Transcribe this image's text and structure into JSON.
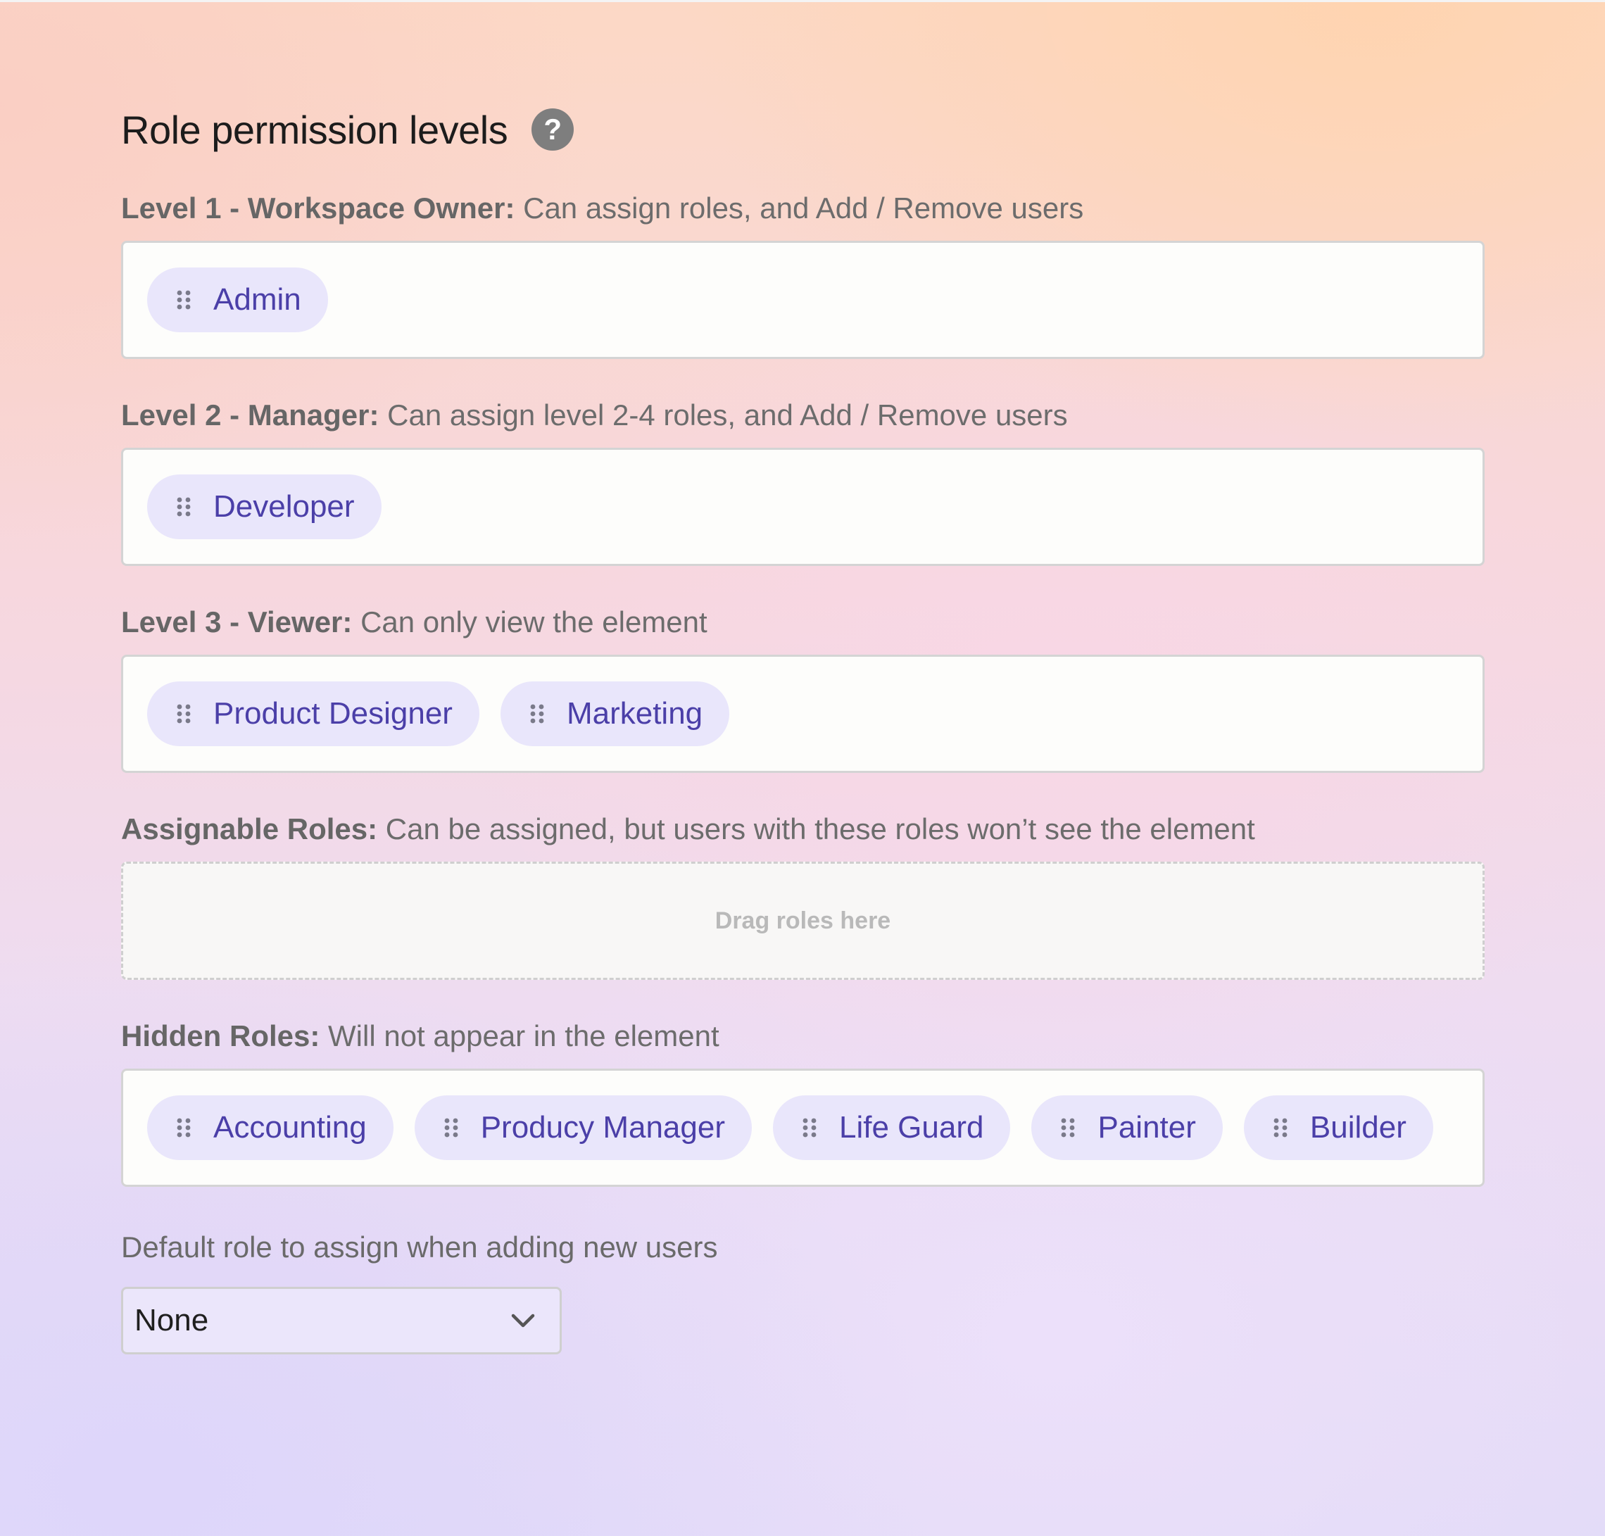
{
  "header": {
    "title": "Role permission levels",
    "help_icon": "?"
  },
  "levels": [
    {
      "strong": "Level 1 - Workspace Owner:",
      "desc": " Can assign roles, and Add / Remove users",
      "roles": [
        "Admin"
      ]
    },
    {
      "strong": "Level 2 - Manager:",
      "desc": " Can assign level 2-4 roles, and Add / Remove users",
      "roles": [
        "Developer"
      ]
    },
    {
      "strong": "Level 3 - Viewer:",
      "desc": " Can only view the element",
      "roles": [
        "Product Designer",
        "Marketing"
      ]
    },
    {
      "strong": "Assignable Roles:",
      "desc": " Can be assigned, but users with these roles won’t see the element",
      "placeholder": "Drag roles here"
    },
    {
      "strong": "Hidden Roles:",
      "desc": " Will not appear in the element",
      "roles": [
        "Accounting",
        "Producy Manager",
        "Life Guard",
        "Painter",
        "Builder"
      ]
    }
  ],
  "default_role": {
    "label": "Default role to assign when adding new users",
    "selected": "None"
  },
  "icons": {
    "drag_handle": "drag-handle-icon",
    "help": "help-icon",
    "dropdown": "chevron-down-icon"
  },
  "colors": {
    "chip_bg": "#e9e6fb",
    "chip_text": "#4b3fa8",
    "help_bg": "#7e7e7e"
  }
}
